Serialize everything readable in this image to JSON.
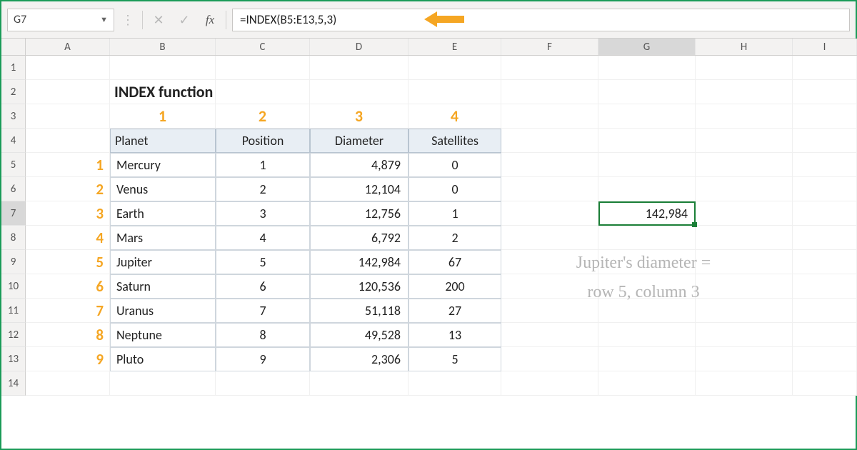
{
  "formula_bar": {
    "cell_ref": "G7",
    "formula": "=INDEX(B5:E13,5,3)",
    "fx_label": "fx",
    "cancel_icon": "✕",
    "confirm_icon": "✓"
  },
  "columns": [
    "A",
    "B",
    "C",
    "D",
    "E",
    "F",
    "G",
    "H",
    "I"
  ],
  "row_numbers": [
    "1",
    "2",
    "3",
    "4",
    "5",
    "6",
    "7",
    "8",
    "9",
    "10",
    "11",
    "12",
    "13",
    "14"
  ],
  "title": "INDEX function",
  "col_labels": [
    "1",
    "2",
    "3",
    "4"
  ],
  "row_labels": [
    "1",
    "2",
    "3",
    "4",
    "5",
    "6",
    "7",
    "8",
    "9"
  ],
  "table": {
    "headers": [
      "Planet",
      "Position",
      "Diameter",
      "Satellites"
    ],
    "rows": [
      {
        "planet": "Mercury",
        "position": "1",
        "diameter": "4,879",
        "satellites": "0"
      },
      {
        "planet": "Venus",
        "position": "2",
        "diameter": "12,104",
        "satellites": "0"
      },
      {
        "planet": "Earth",
        "position": "3",
        "diameter": "12,756",
        "satellites": "1"
      },
      {
        "planet": "Mars",
        "position": "4",
        "diameter": "6,792",
        "satellites": "2"
      },
      {
        "planet": "Jupiter",
        "position": "5",
        "diameter": "142,984",
        "satellites": "67"
      },
      {
        "planet": "Saturn",
        "position": "6",
        "diameter": "120,536",
        "satellites": "200"
      },
      {
        "planet": "Uranus",
        "position": "7",
        "diameter": "51,118",
        "satellites": "27"
      },
      {
        "planet": "Neptune",
        "position": "8",
        "diameter": "49,528",
        "satellites": "13"
      },
      {
        "planet": "Pluto",
        "position": "9",
        "diameter": "2,306",
        "satellites": "5"
      }
    ]
  },
  "result_cell": "142,984",
  "annotation": {
    "line1": "Jupiter's diameter =",
    "line2": "row 5, column 3"
  },
  "colors": {
    "gold": "#f5a623",
    "selection": "#1a7f37"
  }
}
